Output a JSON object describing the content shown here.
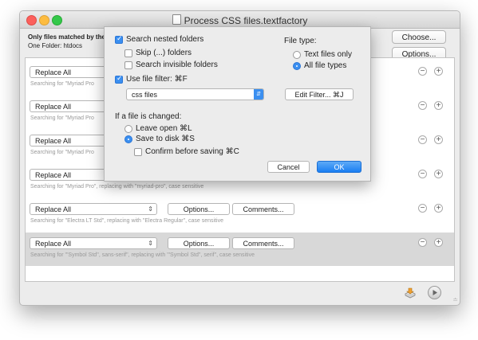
{
  "window": {
    "title": "Process CSS files.textfactory"
  },
  "info": {
    "line1": "Only files matched by the",
    "line2": "One Folder: htdocs"
  },
  "buttons": {
    "choose": "Choose...",
    "options": "Options..."
  },
  "rows": [
    {
      "action": "Replace All",
      "desc": "Searching for \"Myriad Pro",
      "selected": false,
      "show_buttons": false
    },
    {
      "action": "Replace All",
      "desc": "Searching for \"Myriad Pro",
      "selected": false,
      "show_buttons": false
    },
    {
      "action": "Replace All",
      "desc": "Searching for \"Myriad Pro",
      "selected": false,
      "show_buttons": false
    },
    {
      "action": "Replace All",
      "desc": "Searching for \"Myriad Pro\", replacing with \"myriad-pro\", case sensitive",
      "selected": false,
      "show_buttons": false
    },
    {
      "action": "Replace All",
      "desc": "Searching for \"Electra LT Std\", replacing with \"Electra Regular\", case sensitive",
      "selected": false,
      "show_buttons": true
    },
    {
      "action": "Replace All",
      "desc": "Searching for \"'Symbol Std'', sans-serif\", replacing with \"'Symbol Std'', serif\", case sensitive",
      "selected": true,
      "show_buttons": true
    }
  ],
  "row_buttons": {
    "options": "Options...",
    "comments": "Comments...",
    "minus": "−",
    "plus": "+"
  },
  "sheet": {
    "search_nested": "Search nested folders",
    "skip_folders": "Skip (...) folders",
    "search_invisible": "Search invisible folders",
    "use_filter": "Use file filter:  ⌘F",
    "filter_value": "css files",
    "edit_filter": "Edit Filter...  ⌘J",
    "file_type_label": "File type:",
    "text_files_only": "Text files only",
    "all_file_types": "All file types",
    "if_changed_label": "If a file is changed:",
    "leave_open": "Leave open  ⌘L",
    "save_to_disk": "Save to disk  ⌘S",
    "confirm_before_saving": "Confirm before saving  ⌘C",
    "cancel": "Cancel",
    "ok": "OK"
  }
}
